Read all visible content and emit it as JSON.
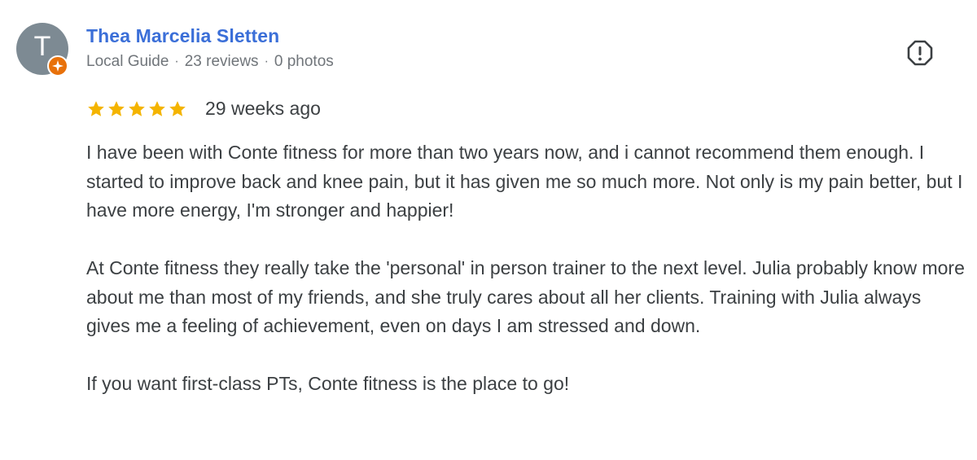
{
  "reviewer": {
    "avatar_letter": "T",
    "name": "Thea Marcelia Sletten",
    "role": "Local Guide",
    "reviews_count": "23 reviews",
    "photos_count": "0 photos",
    "separator": "·"
  },
  "review": {
    "rating": 5,
    "max_rating": 5,
    "date": "29 weeks ago",
    "paragraphs": [
      "I have been with Conte fitness for more than two years now, and i cannot recommend them enough. I started to improve back and knee pain, but it has given me so much more. Not only is my pain better, but I have more energy, I'm stronger and happier!",
      "At Conte fitness they really take the 'personal' in person trainer to the next level. Julia probably know more about me than most of my friends, and she truly cares about all her clients. Training with Julia always gives me a feeling of achievement, even on days I am stressed and down.",
      "If you want first-class PTs, Conte fitness is the place to go!"
    ]
  },
  "icons": {
    "badge": "local-guide-badge-icon",
    "report": "report-flag-icon",
    "star": "star-icon"
  },
  "colors": {
    "name_link": "#3b6fd8",
    "star": "#f4b400",
    "badge": "#e8710a",
    "avatar_bg": "#7d8a93",
    "meta_text": "#70757a",
    "body_text": "#3c4043"
  }
}
